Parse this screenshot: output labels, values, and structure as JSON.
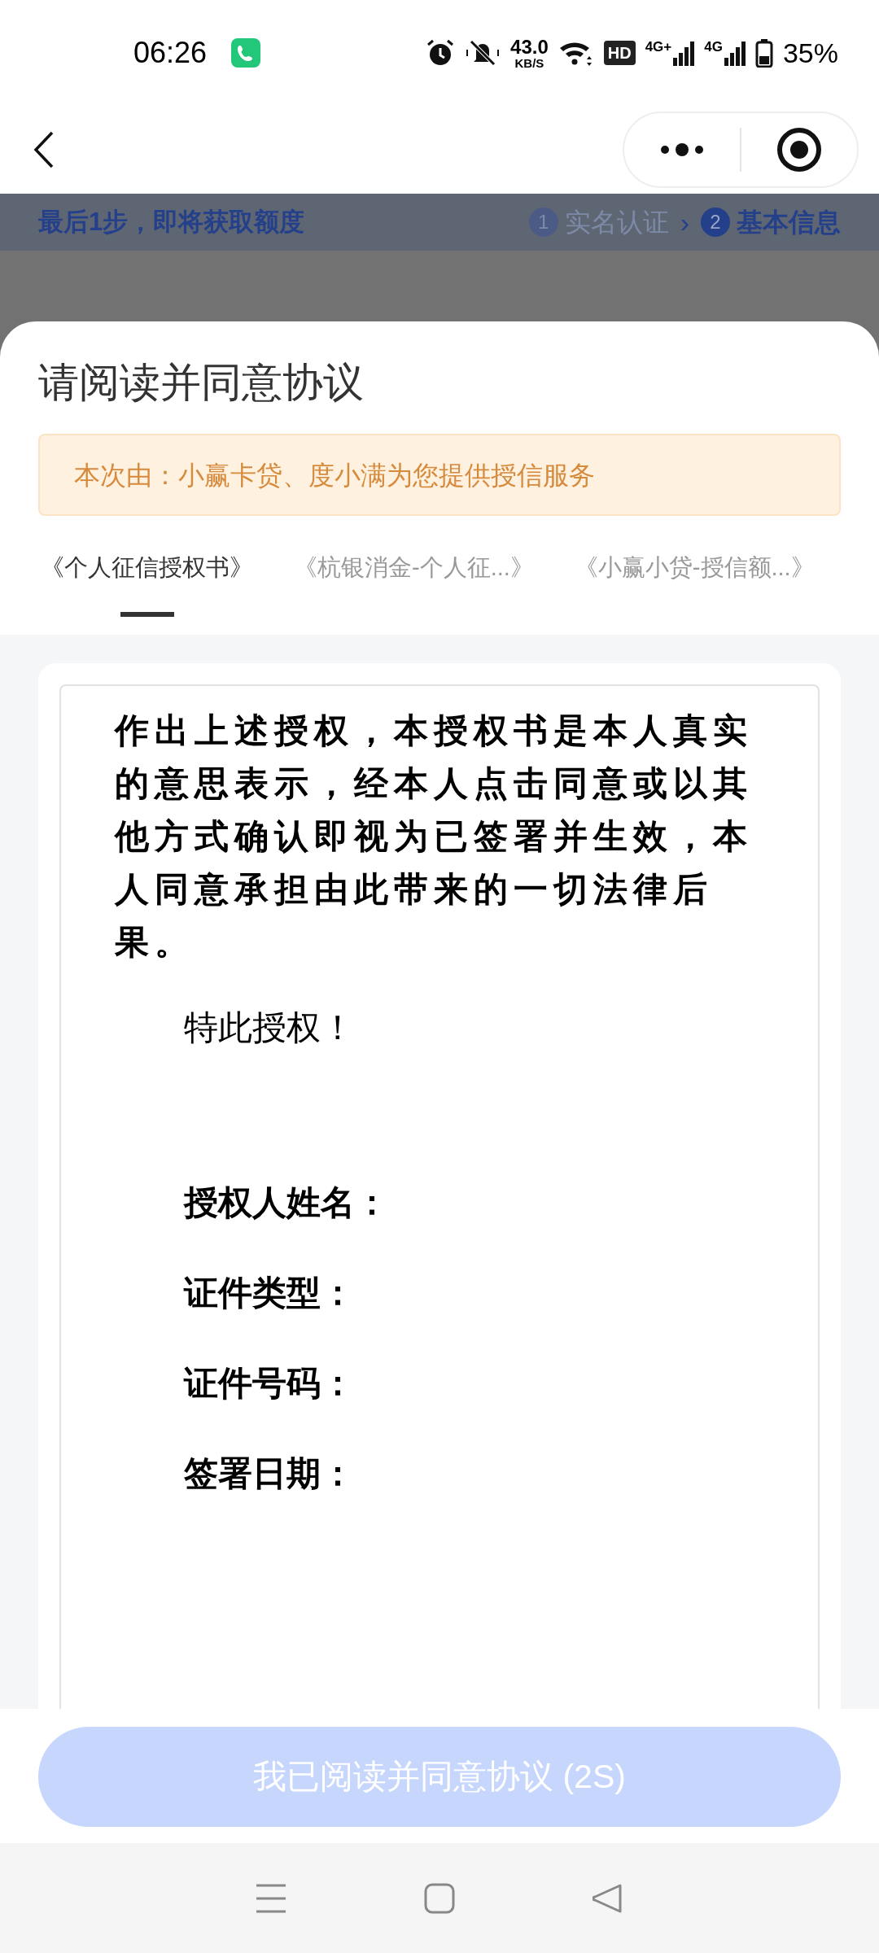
{
  "status_bar": {
    "time": "06:26",
    "net_speed": "43.0",
    "net_unit": "KB/S",
    "hd": "HD",
    "signal_1": "4G+",
    "signal_2": "4G",
    "battery": "35%"
  },
  "step_banner": {
    "text": "最后1步，即将获取额度",
    "steps": [
      {
        "number": "1",
        "label": "实名认证",
        "selected": false
      },
      {
        "number": "2",
        "label": "基本信息",
        "selected": true
      }
    ],
    "separator": "›"
  },
  "sheet": {
    "title": "请阅读并同意协议",
    "notice": "本次由：小赢卡贷、度小满为您提供授信服务",
    "tabs": [
      {
        "label": "《个人征信授权书》",
        "selected": true
      },
      {
        "label": "《杭银消金-个人征...》",
        "selected": false
      },
      {
        "label": "《小赢小贷-授信额...》",
        "selected": false
      }
    ],
    "document": {
      "paragraph": "作出上述授权，本授权书是本人真实的意思表示，经本人点击同意或以其他方式确认即视为已签署并生效，本人同意承担由此带来的一切法律后果。",
      "closing": "特此授权！",
      "fields": [
        "授权人姓名：",
        "证件类型：",
        "证件号码：",
        "签署日期："
      ]
    },
    "agree_button": {
      "label": "我已阅读并同意协议 (2S)",
      "disabled": true
    }
  }
}
